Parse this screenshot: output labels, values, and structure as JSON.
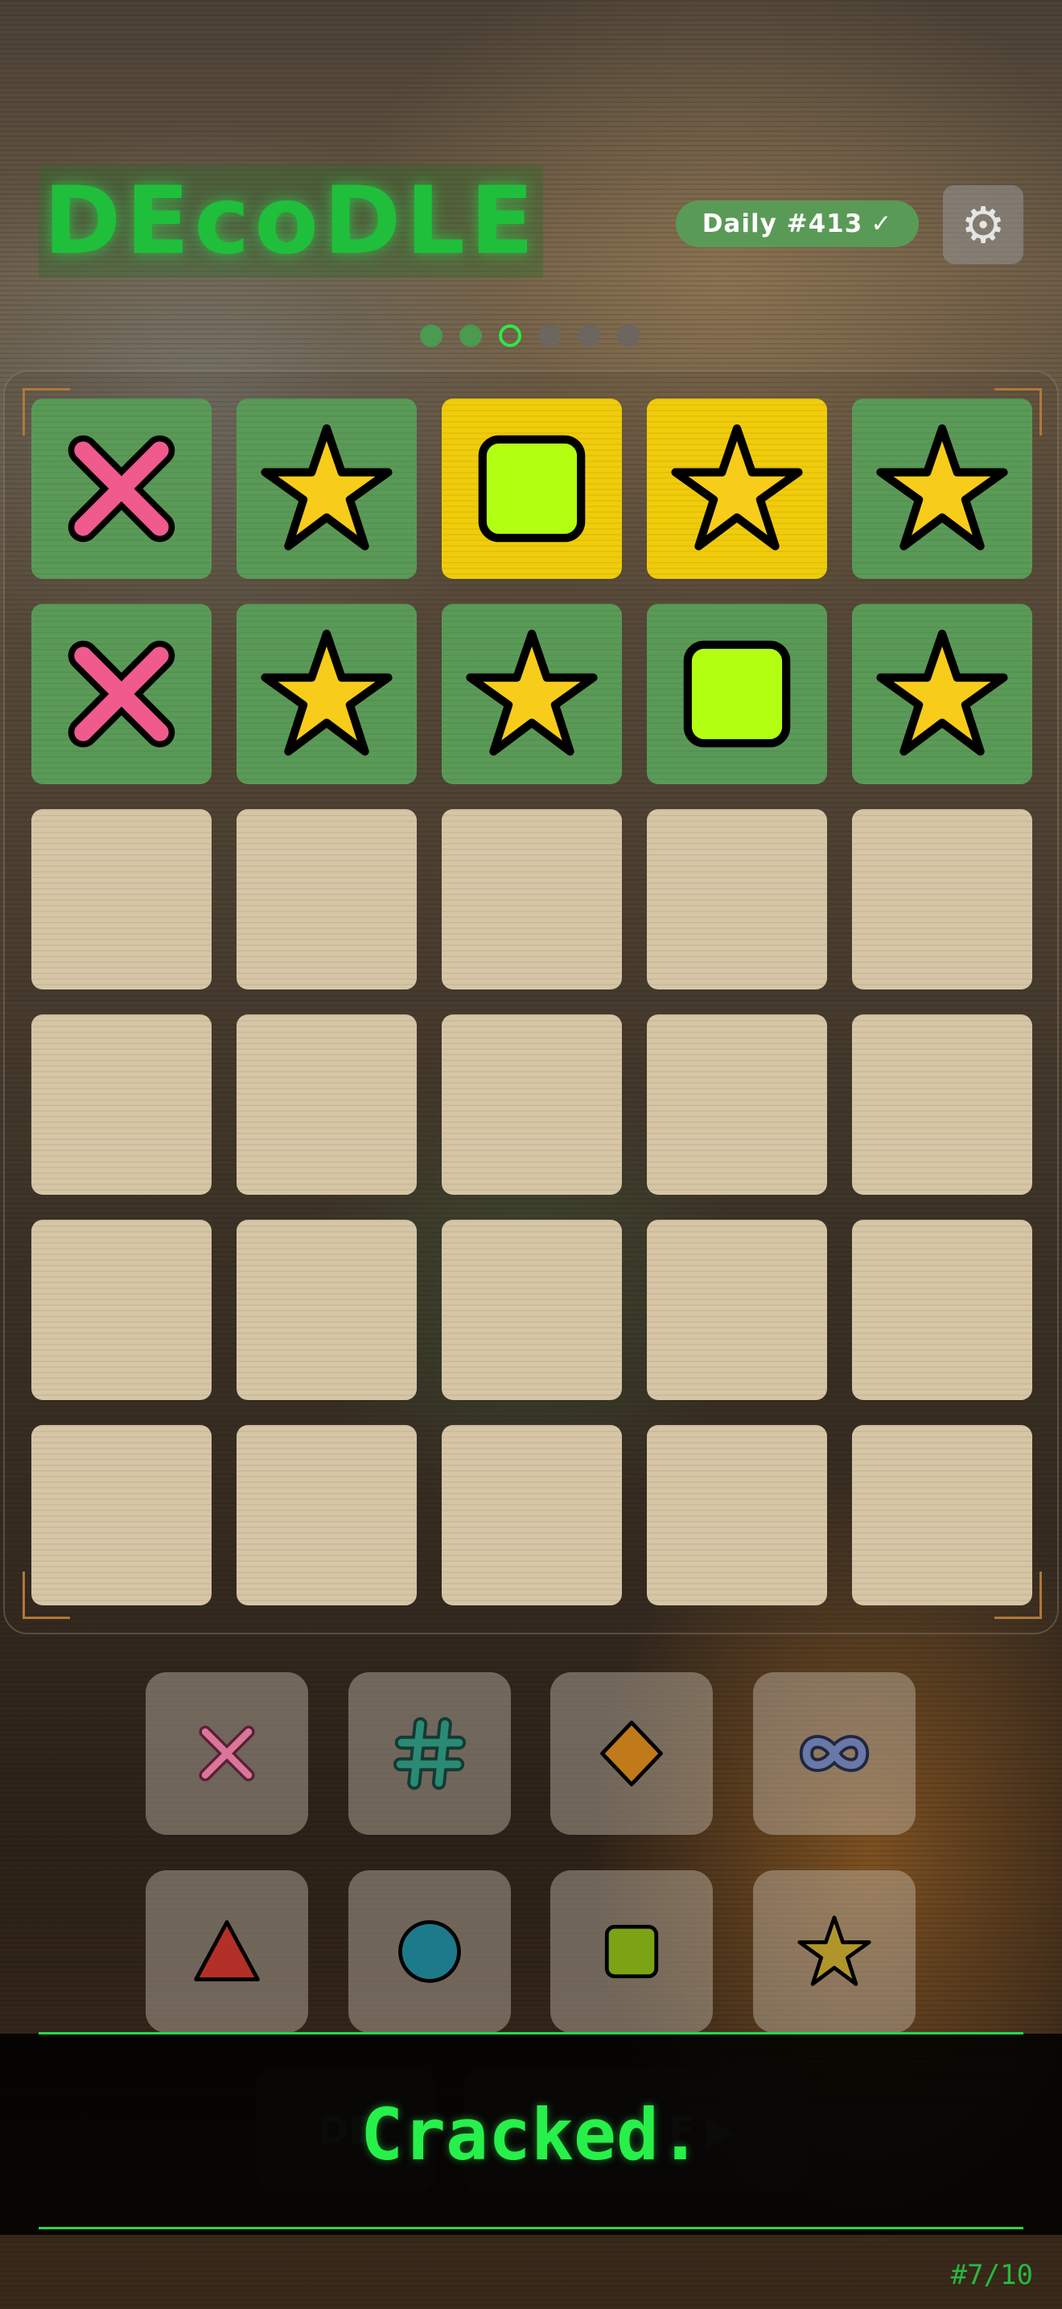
{
  "header": {
    "logo": "DEcoDLE",
    "daily_badge": "Daily #413",
    "daily_check": "✓",
    "settings_icon": "gear-icon",
    "settings_glyph": "⚙"
  },
  "progress_dots": {
    "total": 6,
    "current": 3,
    "completed": 2
  },
  "board": {
    "rows": [
      [
        {
          "symbol": "cross",
          "state": "correct"
        },
        {
          "symbol": "star",
          "state": "correct"
        },
        {
          "symbol": "square",
          "state": "present"
        },
        {
          "symbol": "star",
          "state": "present"
        },
        {
          "symbol": "star",
          "state": "correct"
        }
      ],
      [
        {
          "symbol": "cross",
          "state": "correct"
        },
        {
          "symbol": "star",
          "state": "correct"
        },
        {
          "symbol": "star",
          "state": "correct"
        },
        {
          "symbol": "square",
          "state": "correct"
        },
        {
          "symbol": "star",
          "state": "correct"
        }
      ],
      [
        {
          "state": "empty"
        },
        {
          "state": "empty"
        },
        {
          "state": "empty"
        },
        {
          "state": "empty"
        },
        {
          "state": "empty"
        }
      ],
      [
        {
          "state": "empty"
        },
        {
          "state": "empty"
        },
        {
          "state": "empty"
        },
        {
          "state": "empty"
        },
        {
          "state": "empty"
        }
      ],
      [
        {
          "state": "empty"
        },
        {
          "state": "empty"
        },
        {
          "state": "empty"
        },
        {
          "state": "empty"
        },
        {
          "state": "empty"
        }
      ],
      [
        {
          "state": "empty"
        },
        {
          "state": "empty"
        },
        {
          "state": "empty"
        },
        {
          "state": "empty"
        },
        {
          "state": "empty"
        }
      ]
    ]
  },
  "keyboard": {
    "rows": [
      [
        "cross",
        "hash",
        "diamond",
        "infinity"
      ],
      [
        "triangle",
        "circle",
        "square",
        "star"
      ]
    ]
  },
  "bottom_buttons": {
    "left_label": "DE",
    "right_label": "F ▶"
  },
  "banner": {
    "text": "Cracked."
  },
  "counter": "#7/10",
  "colors": {
    "correct": "#5a9a57",
    "present": "#f0cc0b",
    "empty": "#d6c6a5",
    "accent_green": "#27f04a",
    "cross": "#f05a8c",
    "star": "#f7cc1a",
    "square": "#b3ff12"
  }
}
